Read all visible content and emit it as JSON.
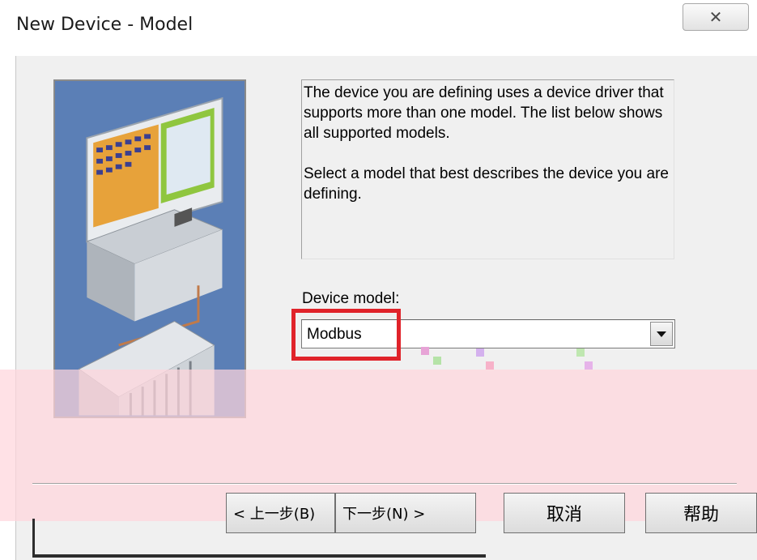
{
  "window": {
    "title": "New Device - Model",
    "close_icon": "close-icon"
  },
  "description": {
    "paragraph1": "The device you are defining uses a device driver that supports more than one model.  The list below shows all supported models.",
    "paragraph2": "Select  a model that best describes the device you are defining."
  },
  "device_model": {
    "label": "Device model:",
    "value": "Modbus"
  },
  "buttons": {
    "back": "< 上一步(B)",
    "next": "下一步(N) >",
    "cancel": "取消",
    "help": "帮助"
  },
  "colors": {
    "highlight": "#e0232a",
    "illustration_bg": "#5b7fb6",
    "overlay": "#ffd6dc"
  }
}
